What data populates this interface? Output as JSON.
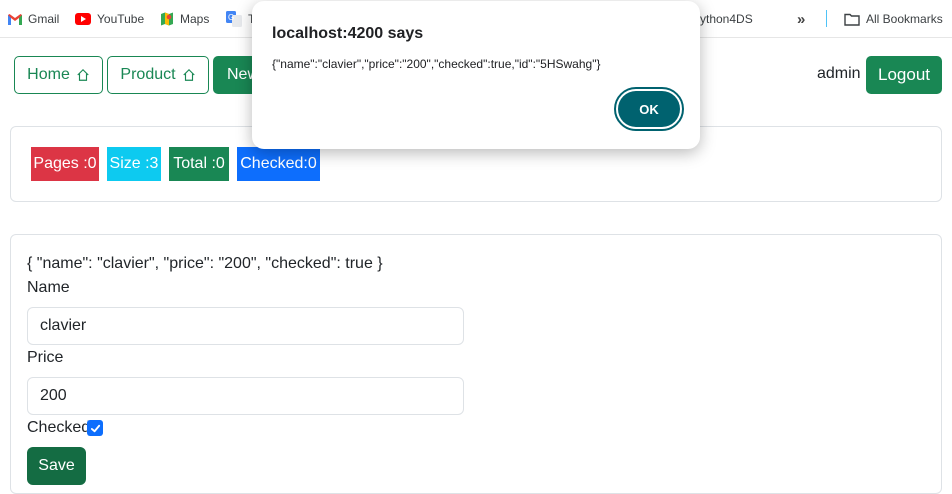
{
  "bookmarks": {
    "items": [
      {
        "label": "Gmail",
        "icon": "gmail-icon"
      },
      {
        "label": "YouTube",
        "icon": "youtube-icon"
      },
      {
        "label": "Maps",
        "icon": "maps-icon"
      },
      {
        "label": "T",
        "icon": "translate-icon"
      },
      {
        "label": "ython4DS"
      }
    ],
    "overflow_icon": "double-chevron-icon",
    "all_bookmarks_label": "All Bookmarks",
    "folder_icon": "folder-icon"
  },
  "navbar": {
    "home_label": "Home",
    "product_label": "Product",
    "new_label": "New",
    "house_icon": "house-icon",
    "user": "admin",
    "logout_label": "Logout"
  },
  "stats": {
    "pages": "Pages :0",
    "size": "Size :3",
    "total": "Total :0",
    "checked": "Checked:0"
  },
  "form": {
    "json_preview": "{ \"name\": \"clavier\", \"price\": \"200\", \"checked\": true }",
    "name_label": "Name",
    "name_value": "clavier",
    "price_label": "Price",
    "price_value": "200",
    "checked_label": "Checked",
    "checked": true,
    "save_label": "Save"
  },
  "alert": {
    "title": "localhost:4200 says",
    "message": "{\"name\":\"clavier\",\"price\":\"200\",\"checked\":true,\"id\":\"5HSwahg\"}",
    "ok_label": "OK"
  },
  "colors": {
    "success": "#198754",
    "danger": "#dc3545",
    "info": "#0dcaf0",
    "primary": "#0d6efd",
    "dialog_button": "#00626f"
  }
}
